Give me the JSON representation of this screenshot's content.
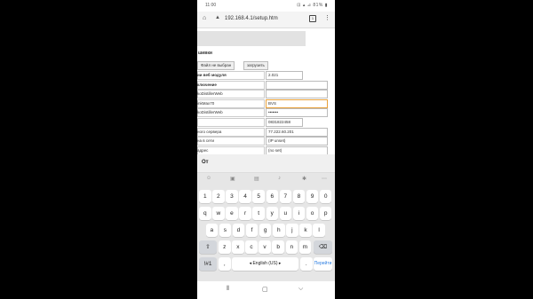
{
  "status": {
    "time": "11:00",
    "icons": "⊡ ▴ ⊿ 81% ▮"
  },
  "browser": {
    "url": "192.168.4.1/setup.htm",
    "tab_count": "1"
  },
  "page": {
    "section_title": "шивки",
    "file_button": "Файл не выбран",
    "upload_button": "загрузить",
    "rows": [
      {
        "label": "ии веб модуля",
        "value": "2.021",
        "bold": true,
        "short": true
      },
      {
        "label": "ключение",
        "value": "",
        "bold": true
      },
      {
        "label": "koDistillerWeb",
        "value": ""
      },
      {
        "label": "inkMax70",
        "value": "BVS",
        "focus": true
      },
      {
        "label": "koDistillerWeb",
        "value": "•••••••"
      },
      {
        "label": "",
        "value": "0831822458",
        "short": true
      },
      {
        "label": "ного сервера",
        "value": "77.222.60.201"
      },
      {
        "label": "на в сети",
        "value": "(IP unset)"
      },
      {
        "label": "адрес",
        "value": "(no set)"
      },
      {
        "label": "одали 20(2)",
        "value": "Обычный 20(2)"
      }
    ]
  },
  "keyboard": {
    "suggestion": "От",
    "number_row": [
      "1",
      "2",
      "3",
      "4",
      "5",
      "6",
      "7",
      "8",
      "9",
      "0"
    ],
    "row1": [
      "q",
      "w",
      "e",
      "r",
      "t",
      "y",
      "u",
      "i",
      "o",
      "p"
    ],
    "row2": [
      "a",
      "s",
      "d",
      "f",
      "g",
      "h",
      "j",
      "k",
      "l"
    ],
    "row3": [
      "z",
      "x",
      "c",
      "v",
      "b",
      "n",
      "m"
    ],
    "symbols_key": "!#1",
    "comma_key": ",",
    "space_label": "◂ English (US) ▸",
    "period_key": ".",
    "enter_label": "Перейти"
  }
}
